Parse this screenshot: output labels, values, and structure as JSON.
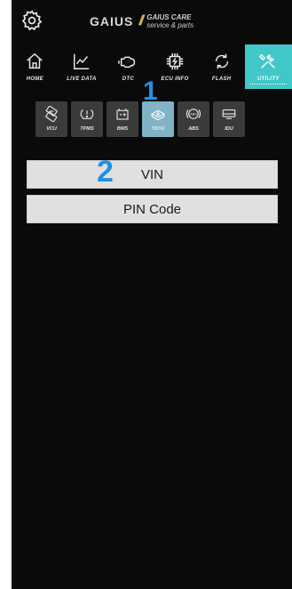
{
  "header": {
    "brand": "GAIUS",
    "brand_slash": "//",
    "sub_line1": "GAIUS CARE",
    "sub_line2": "service & parts"
  },
  "main_nav": [
    {
      "label": "HOME",
      "icon": "home-icon"
    },
    {
      "label": "LIVE DATA",
      "icon": "line-chart-icon"
    },
    {
      "label": "DTC",
      "icon": "engine-icon"
    },
    {
      "label": "ECU INFO",
      "icon": "chip-icon"
    },
    {
      "label": "FLASH",
      "icon": "refresh-icon"
    },
    {
      "label": "UTILITY",
      "icon": "tools-icon",
      "active": true
    }
  ],
  "sub_nav": [
    {
      "label": "VCU",
      "icon": "vcu-icon"
    },
    {
      "label": "TPMS",
      "icon": "tire-pressure-icon"
    },
    {
      "label": "BMS",
      "icon": "battery-icon"
    },
    {
      "label": "TBOX",
      "icon": "tbox-icon",
      "active": true
    },
    {
      "label": "ABS",
      "icon": "abs-icon"
    },
    {
      "label": "IDU",
      "icon": "display-unit-icon"
    }
  ],
  "markers": {
    "one": "1",
    "two": "2"
  },
  "actions": {
    "vin_label": "VIN",
    "pin_label": "PIN Code"
  },
  "colors": {
    "accent": "#41c7c7",
    "active_sub": "#7fb3c5",
    "marker": "#1e90e8",
    "background": "#0a0a0a"
  }
}
